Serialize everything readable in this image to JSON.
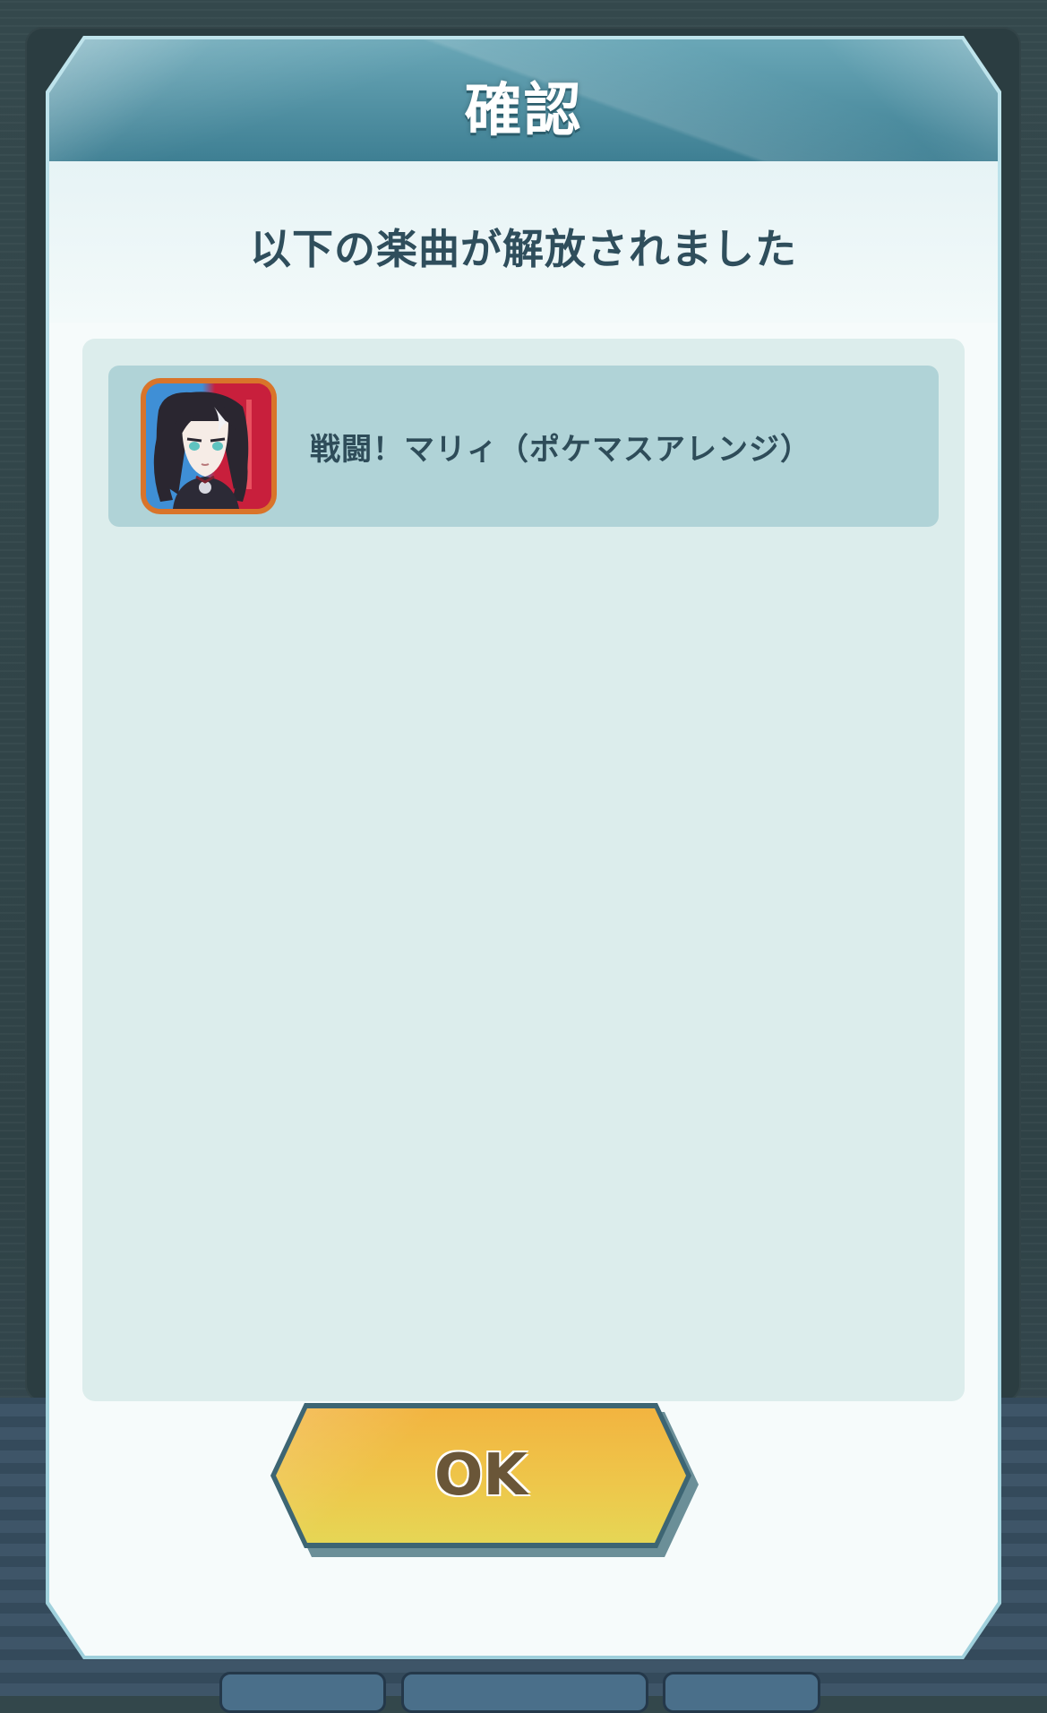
{
  "dialog": {
    "title": "確認",
    "message": "以下の楽曲が解放されました"
  },
  "unlocked_tracks": [
    {
      "title": "戦闘！マリィ（ポケマスアレンジ）",
      "icon": "marnie-portrait-icon"
    }
  ],
  "ok_button": {
    "label": "OK"
  },
  "colors": {
    "header": "#3e7f93",
    "list_background": "#dcedec",
    "item_background": "#b0d3d7",
    "button": "#eec64a"
  }
}
